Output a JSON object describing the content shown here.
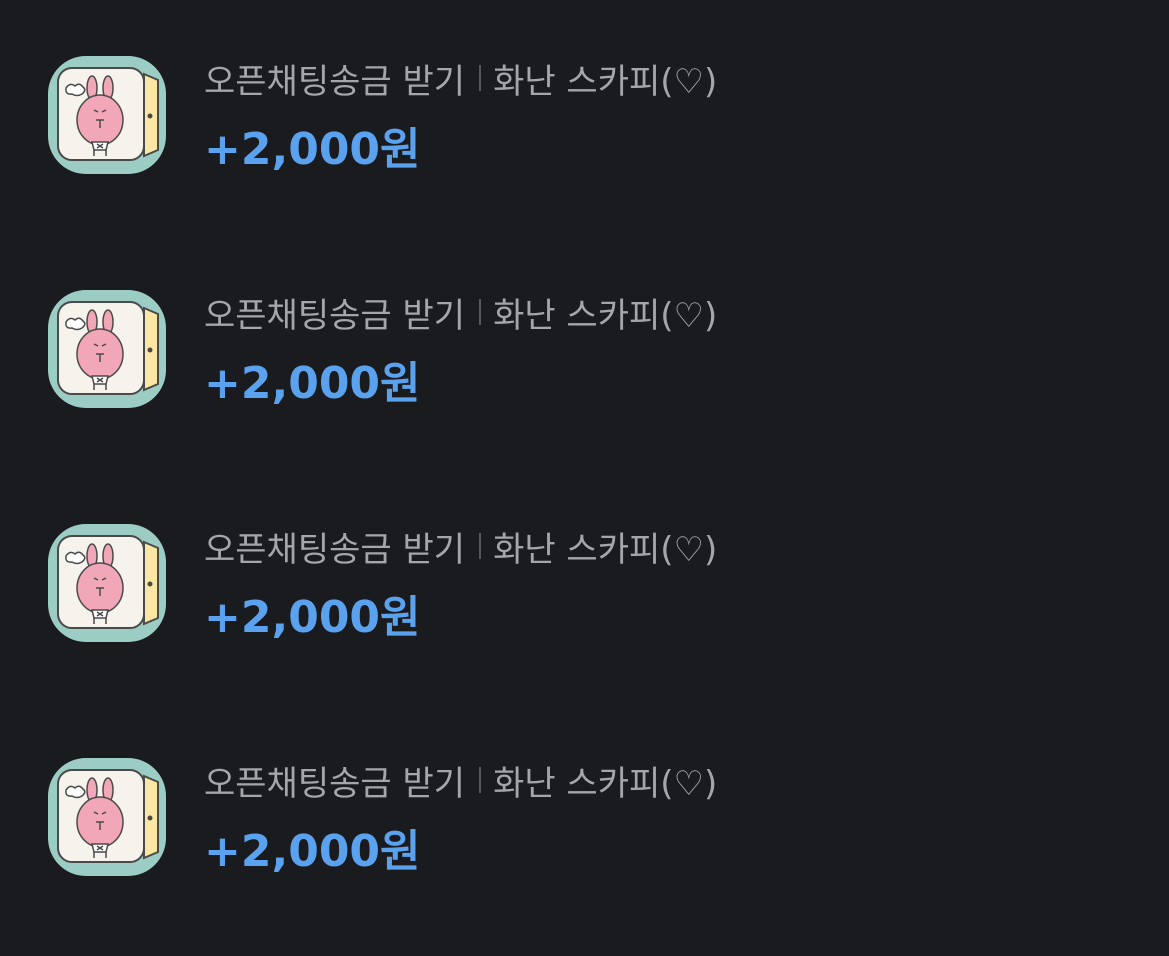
{
  "colors": {
    "background": "#1a1b1f",
    "meta_text": "#a5a6ab",
    "amount_text": "#5aa2ee",
    "avatar_frame": "#9ccdc5",
    "avatar_face": "#f2a7b8",
    "avatar_door": "#fbe6a3"
  },
  "transactions": [
    {
      "avatar_icon": "pink-bunny-door-icon",
      "type": "오픈채팅송금 받기",
      "sender": "화난 스카피(♡)",
      "amount": "+2,000원"
    },
    {
      "avatar_icon": "pink-bunny-door-icon",
      "type": "오픈채팅송금 받기",
      "sender": "화난 스카피(♡)",
      "amount": "+2,000원"
    },
    {
      "avatar_icon": "pink-bunny-door-icon",
      "type": "오픈채팅송금 받기",
      "sender": "화난 스카피(♡)",
      "amount": "+2,000원"
    },
    {
      "avatar_icon": "pink-bunny-door-icon",
      "type": "오픈채팅송금 받기",
      "sender": "화난 스카피(♡)",
      "amount": "+2,000원"
    }
  ]
}
